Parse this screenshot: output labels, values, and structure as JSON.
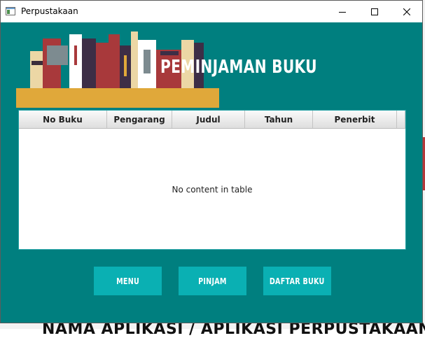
{
  "window": {
    "title": "Perpustakaan",
    "icons": {
      "app": "app-window-icon",
      "minimize": "minimize-icon",
      "maximize": "maximize-icon",
      "close": "close-icon"
    }
  },
  "background_app": {
    "bottom_text": "NAMA APLIKASI / APLIKASI PERPUSTAKAAN"
  },
  "header": {
    "title": "PEMINJAMAN BUKU",
    "logo_icon": "bookshelf-icon"
  },
  "table": {
    "columns": [
      "No Buku",
      "Pengarang",
      "Judul",
      "Tahun",
      "Penerbit"
    ],
    "rows": [],
    "empty_message": "No content in table"
  },
  "actions": {
    "menu": "MENU",
    "pinjam": "PINJAM",
    "daftar_buku": "DAFTAR BUKU"
  },
  "colors": {
    "background": "#007f7f",
    "button": "#0ab0b3",
    "table_border": "#1fa0a3",
    "shelf": "#e0a83a"
  }
}
